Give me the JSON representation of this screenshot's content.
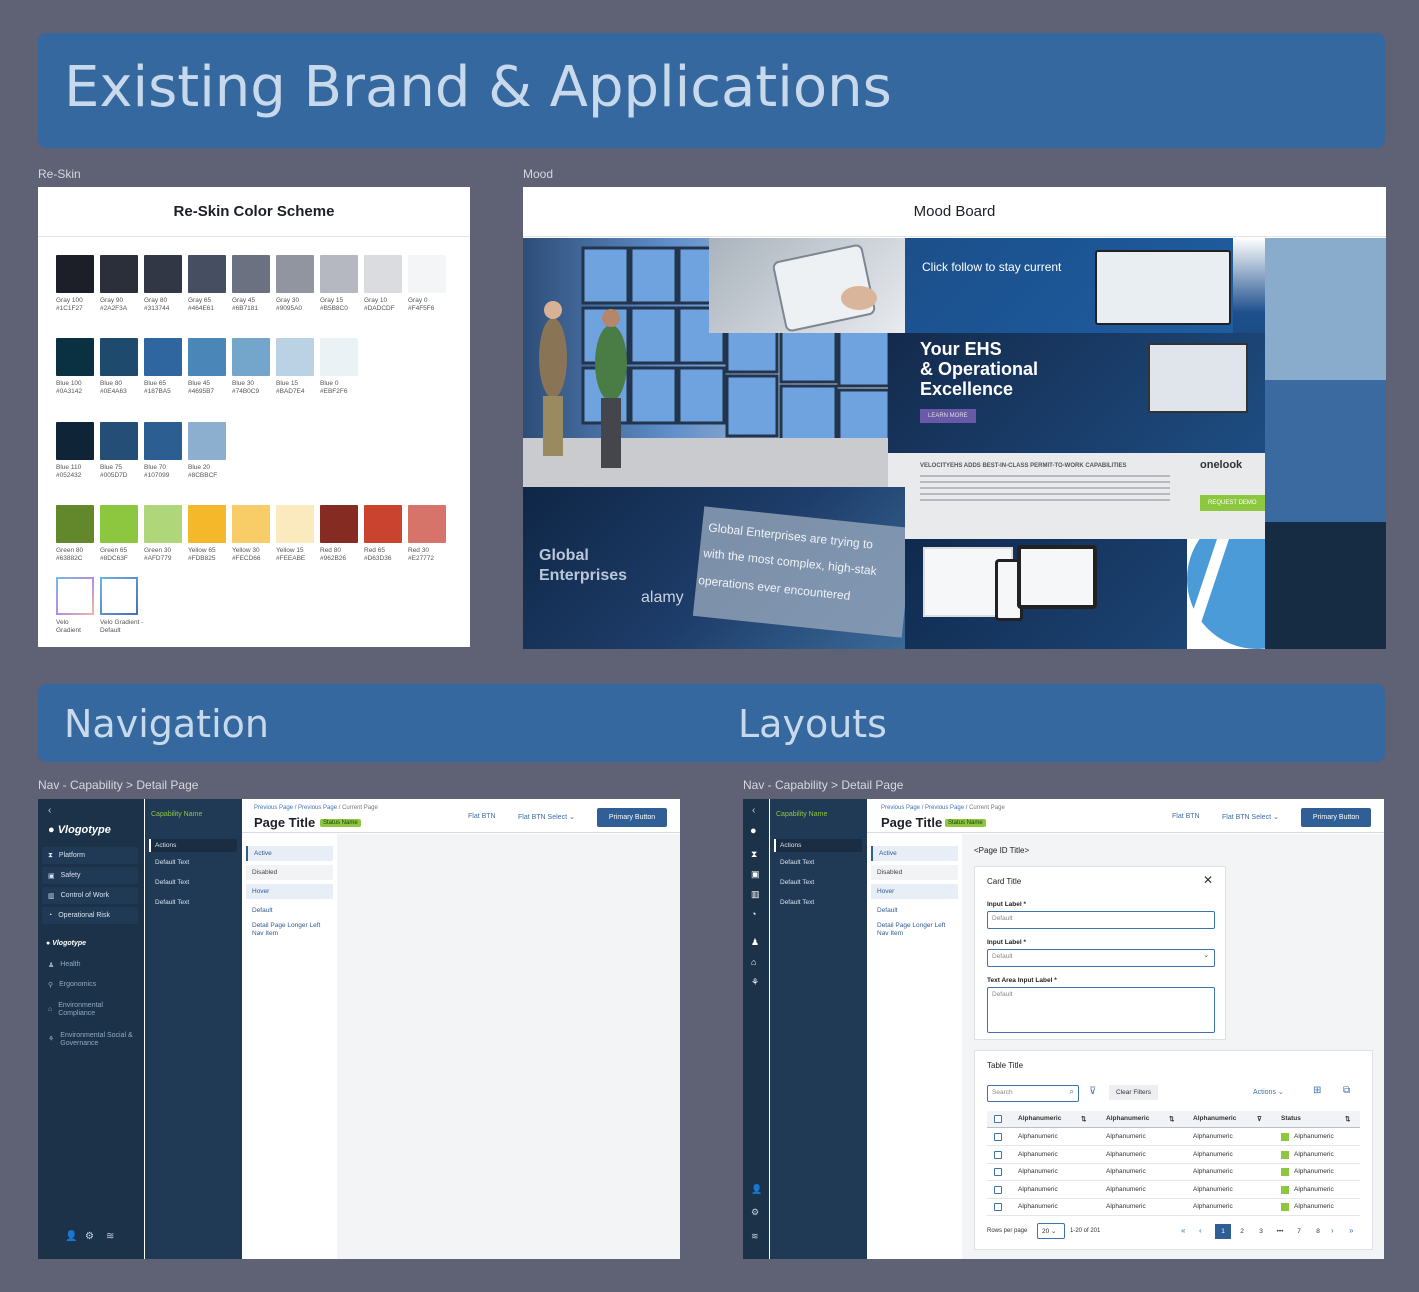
{
  "banners": {
    "existing": "Existing Brand & Applications",
    "navigation": "Navigation",
    "layouts": "Layouts"
  },
  "captions": {
    "reskin": "Re-Skin",
    "mood": "Mood",
    "nav_detail": "Nav - Capability >  Detail Page",
    "layout_detail": "Nav - Capability >  Detail Page"
  },
  "reskin": {
    "title": "Re-Skin Color Scheme",
    "rows": [
      [
        {
          "name": "Gray 100",
          "hex": "#1C1F27",
          "color": "#1c1f27"
        },
        {
          "name": "Gray 90",
          "hex": "#2A2F3A",
          "color": "#2a2f3a"
        },
        {
          "name": "Gray 80",
          "hex": "#313744",
          "color": "#313744"
        },
        {
          "name": "Gray 65",
          "hex": "#464E61",
          "color": "#464e61"
        },
        {
          "name": "Gray 45",
          "hex": "#6B7181",
          "color": "#6b7181"
        },
        {
          "name": "Gray 30",
          "hex": "#9095A0",
          "color": "#9095a0"
        },
        {
          "name": "Gray 15",
          "hex": "#B5B8C0",
          "color": "#b5b8c0"
        },
        {
          "name": "Gray 10",
          "hex": "#DADCDF",
          "color": "#dadcdf"
        },
        {
          "name": "Gray 0",
          "hex": "#F4F5F6",
          "color": "#f4f5f6"
        }
      ],
      [
        {
          "name": "Blue 100",
          "hex": "#0A3142",
          "color": "#0a3142"
        },
        {
          "name": "Blue 80",
          "hex": "#0E4A63",
          "color": "#1e4a6e"
        },
        {
          "name": "Blue 65",
          "hex": "#187BA5",
          "color": "#2f66a0"
        },
        {
          "name": "Blue 45",
          "hex": "#4695B7",
          "color": "#4a86b8"
        },
        {
          "name": "Blue 30",
          "hex": "#74B0C9",
          "color": "#74a6cc"
        },
        {
          "name": "Blue 15",
          "hex": "#BAD7E4",
          "color": "#bad2e4"
        },
        {
          "name": "Blue 0",
          "hex": "#EBF2F6",
          "color": "#ebf2f6"
        }
      ],
      [
        {
          "name": "Blue 110",
          "hex": "#052432",
          "color": "#0f2436"
        },
        {
          "name": "Blue 75",
          "hex": "#005D7D",
          "color": "#244e76"
        },
        {
          "name": "Blue 70",
          "hex": "#107099",
          "color": "#2d5e92"
        },
        {
          "name": "Blue 20",
          "hex": "#8CBBCF",
          "color": "#8cafcf"
        }
      ],
      [
        {
          "name": "Green 80",
          "hex": "#63882C",
          "color": "#63882c"
        },
        {
          "name": "Green 65",
          "hex": "#8DC63F",
          "color": "#8dc63f"
        },
        {
          "name": "Green 30",
          "hex": "#AFD779",
          "color": "#afd779"
        },
        {
          "name": "Yellow 65",
          "hex": "#FDB825",
          "color": "#f5b82a"
        },
        {
          "name": "Yellow 30",
          "hex": "#FECD66",
          "color": "#f8cc66"
        },
        {
          "name": "Yellow 15",
          "hex": "#FEEABE",
          "color": "#fbeabe"
        },
        {
          "name": "Red 80",
          "hex": "#962B26",
          "color": "#862b22"
        },
        {
          "name": "Red 65",
          "hex": "#D63D36",
          "color": "#c9432f"
        },
        {
          "name": "Red 30",
          "hex": "#E27772",
          "color": "#d6746a"
        }
      ],
      [
        {
          "name": "Velo",
          "hex": "Gradient",
          "color": "gradient"
        },
        {
          "name": "Velo Gradient -",
          "hex": "Default",
          "color": "gradient"
        }
      ]
    ]
  },
  "mood": {
    "title": "Mood Board",
    "follow": "Click follow to stay current",
    "headline": [
      "Your EHS",
      "& Operational",
      "Excellence"
    ],
    "learn": "LEARN MORE",
    "news_title": "VELOCITYEHS ADDS BEST-IN-CLASS PERMIT-TO-WORK CAPABILITIES",
    "onelook": "onelook",
    "request": "REQUEST DEMO",
    "global": [
      "Global",
      "Enterprises"
    ],
    "blur": [
      "Global Enterprises are trying to",
      "with the most complex, high-stak",
      "operations ever encountered"
    ],
    "alamy": "alamy"
  },
  "nav": {
    "logo": "Vlogotype",
    "main_items": [
      "Platform",
      "Safety",
      "Control of Work",
      "Operational Risk"
    ],
    "section": "Vlogotype",
    "dim_items": [
      "Health",
      "Ergonomics",
      "Environmental Compliance",
      "Environmental Social & Governance"
    ],
    "capability": "Capability Name",
    "actions": "Actions",
    "default_text": "Default Text",
    "crumbs": [
      "Previous Page",
      "Previous Page",
      "Current Page"
    ],
    "page_title": "Page Title",
    "status": "Status Name",
    "flat_btn": "Flat BTN",
    "flat_select": "Flat BTN Select",
    "primary": "Primary Button",
    "left_nav": [
      "Active",
      "Disabled",
      "Hover",
      "Default",
      "Detail Page Longer Left Nav Item"
    ]
  },
  "layout": {
    "page_id": "<Page ID Title>",
    "card_title": "Card Title",
    "input_label": "Input Label",
    "default": "Default",
    "textarea_label": "Text Area Input Label",
    "table_title": "Table Title",
    "search": "Search",
    "clear_filters": "Clear Filters",
    "actions": "Actions",
    "columns": [
      "Alphanumeric",
      "Alphanumeric",
      "Alphanumeric",
      "Status"
    ],
    "rows": [
      [
        "Alphanumeric",
        "Alphanumeric",
        "Alphanumeric",
        "Alphanumeric"
      ],
      [
        "Alphanumeric",
        "Alphanumeric",
        "Alphanumeric",
        "Alphanumeric"
      ],
      [
        "Alphanumeric",
        "Alphanumeric",
        "Alphanumeric",
        "Alphanumeric"
      ],
      [
        "Alphanumeric",
        "Alphanumeric",
        "Alphanumeric",
        "Alphanumeric"
      ],
      [
        "Alphanumeric",
        "Alphanumeric",
        "Alphanumeric",
        "Alphanumeric"
      ]
    ],
    "rows_per_page": "Rows per page",
    "rpp_value": "20",
    "range": "1-20 of 201",
    "pages": [
      "1",
      "2",
      "3",
      "•••",
      "7",
      "8"
    ]
  }
}
